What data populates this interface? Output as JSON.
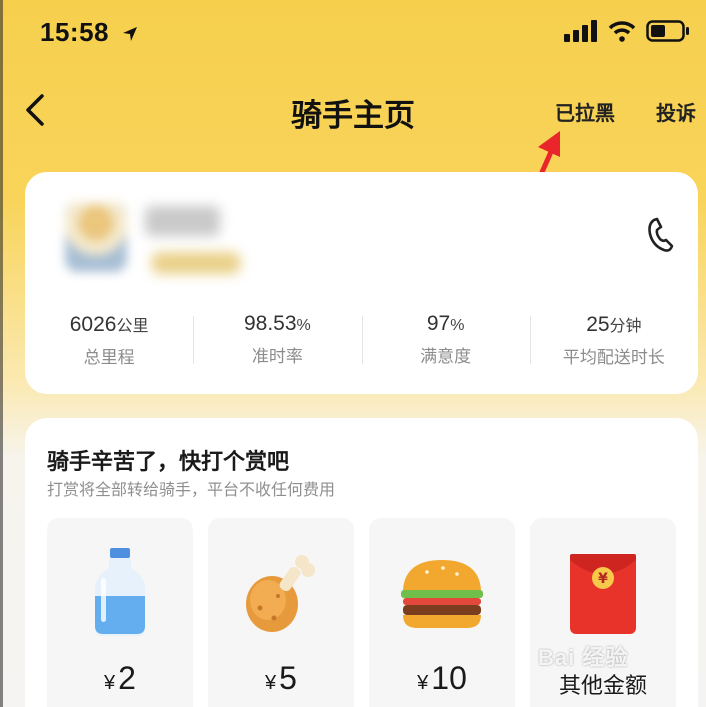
{
  "status_bar": {
    "time": "15:58"
  },
  "nav": {
    "title": "骑手主页",
    "blocked_label": "已拉黑",
    "complain_label": "投诉"
  },
  "rider": {
    "stats": [
      {
        "value": "6026",
        "unit": "公里",
        "label": "总里程"
      },
      {
        "value": "98.53",
        "unit": "%",
        "label": "准时率"
      },
      {
        "value": "97",
        "unit": "%",
        "label": "满意度"
      },
      {
        "value": "25",
        "unit": "分钟",
        "label": "平均配送时长"
      }
    ]
  },
  "tip": {
    "title": "骑手辛苦了，快打个赏吧",
    "subtitle": "打赏将全部转给骑手，平台不收任何费用",
    "currency": "¥",
    "options": [
      {
        "icon": "water-bottle-icon",
        "amount": "2"
      },
      {
        "icon": "chicken-leg-icon",
        "amount": "5"
      },
      {
        "icon": "burger-icon",
        "amount": "10"
      },
      {
        "icon": "red-envelope-icon",
        "label": "其他金额"
      }
    ]
  },
  "watermark": "Bai 经验",
  "colors": {
    "header_yellow": "#f6cf4d",
    "arrow_red": "#e8262b",
    "card_bg": "#ffffff"
  }
}
